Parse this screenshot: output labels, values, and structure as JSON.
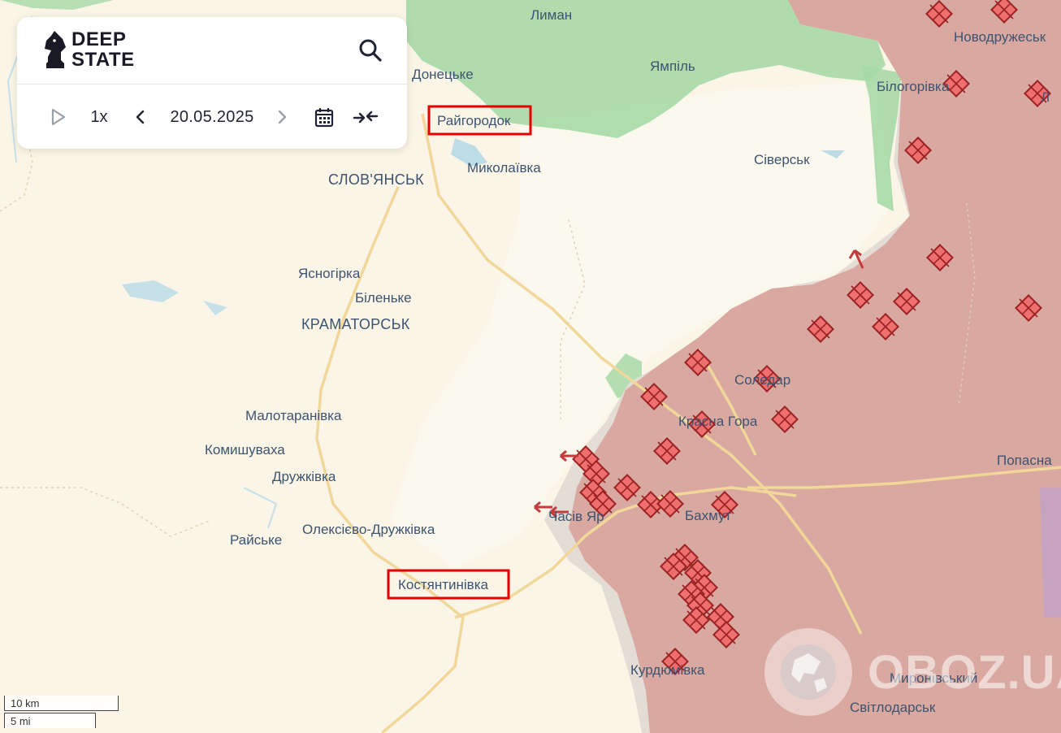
{
  "app": {
    "logo_line1": "DEEP",
    "logo_line2": "STATE"
  },
  "controls": {
    "speed": "1x",
    "date": "20.05.2025",
    "icons": [
      "play-icon",
      "chevron-left-icon",
      "chevron-right-icon",
      "calendar-icon",
      "collapse-icon",
      "search-icon"
    ]
  },
  "colors": {
    "occupied": "#d9a8a0",
    "liberated": "#9fd6a3",
    "contested_gray": "#e4ddd5",
    "base": "#faf5e6",
    "highlight_box": "#e60000"
  },
  "places": {
    "lyman": "Лиман",
    "novodruzhesk": "Новодружеськ",
    "donetske": "Донецьке",
    "yampil": "Ямпіль",
    "bilohorivka": "Білогорівка",
    "lysychansk_partial": "Л",
    "raihorodok": "Райгородок",
    "sloviansk": "СЛОВ'ЯНСЬК",
    "mykolaivka": "Миколаївка",
    "siversk": "Сіверськ",
    "yasnohirka": "Ясногірка",
    "bilenke": "Біленьке",
    "kramatorsk": "КРАМАТОРСЬК",
    "soledar": "Соледар",
    "krasna_hora": "Красна Гора",
    "malotaranivka": "Малотаранівка",
    "komyshuvakha": "Комишуваха",
    "popasna": "Попасна",
    "druzhkivka": "Дружківка",
    "chasiv_yar": "Часів Яр",
    "bakhmut": "Бахмут",
    "raiske": "Райське",
    "oleksievo": "Олексієво-Дружківка",
    "kostiantynivka": "Костянтинівка",
    "kurdiumivka": "Курдюмівка",
    "myronivskyi": "Миронівський",
    "svitlodarsk": "Світлодарськ"
  },
  "scale": {
    "km": "10 km",
    "mi": "5 mi"
  },
  "watermark": {
    "text": "OBOZ.UA"
  }
}
